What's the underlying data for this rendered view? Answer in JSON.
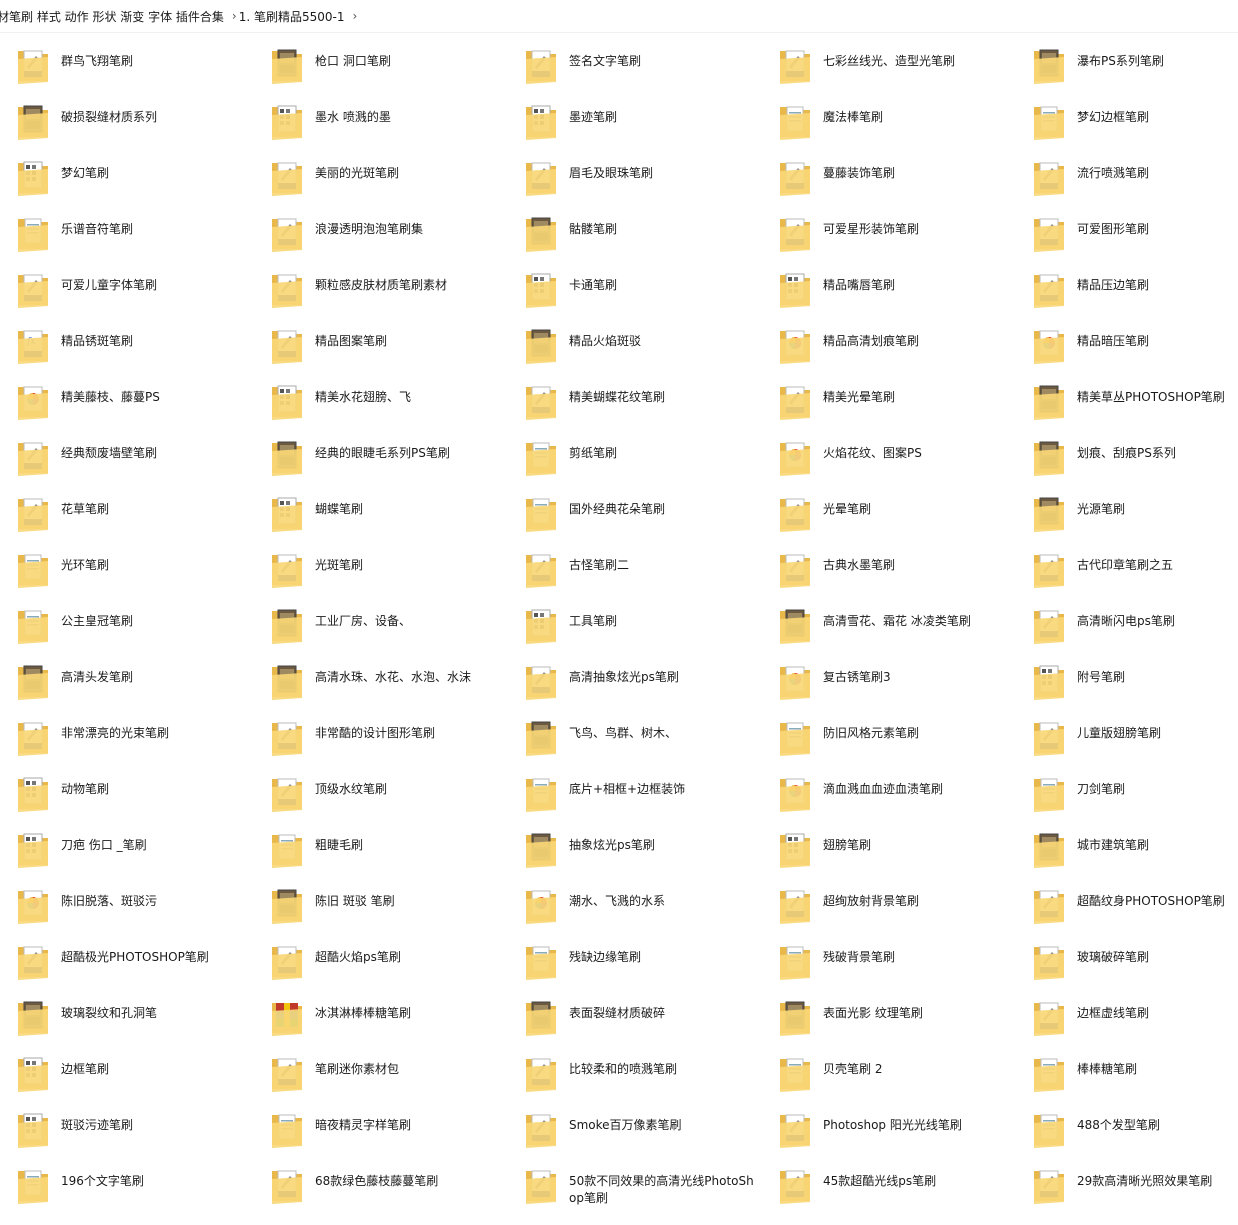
{
  "breadcrumb": {
    "items": [
      "材笔刷 样式 动作 形状 渐变 字体 插件合集",
      "1. 笔刷精品5500-1"
    ],
    "separator": "›"
  },
  "colors": {
    "folder_back": "#e8b84a",
    "folder_front": "#f8d775",
    "thumb_blue": "#1f3a93"
  },
  "folders": [
    {
      "name": "群鸟飞翔笔刷",
      "icon": "brushes-icon"
    },
    {
      "name": "枪口 洞口笔刷",
      "icon": "photo-icon"
    },
    {
      "name": "签名文字笔刷",
      "icon": "brushes-icon"
    },
    {
      "name": "七彩丝线光、造型光笔刷",
      "icon": "brushes-icon"
    },
    {
      "name": "瀑布PS系列笔刷",
      "icon": "photo-icon"
    },
    {
      "name": "破损裂缝材质系列",
      "icon": "photo-icon"
    },
    {
      "name": "墨水 喷溅的墨",
      "icon": "sheet-icon"
    },
    {
      "name": "墨迹笔刷",
      "icon": "sheet-icon"
    },
    {
      "name": "魔法棒笔刷",
      "icon": "doc-icon"
    },
    {
      "name": "梦幻边框笔刷",
      "icon": "doc-icon"
    },
    {
      "name": "梦幻笔刷",
      "icon": "sheet-icon"
    },
    {
      "name": "美丽的光斑笔刷",
      "icon": "brushes-icon"
    },
    {
      "name": "眉毛及眼珠笔刷",
      "icon": "brushes-icon"
    },
    {
      "name": "蔓藤装饰笔刷",
      "icon": "brushes-icon"
    },
    {
      "name": "流行喷溅笔刷",
      "icon": "brushes-icon"
    },
    {
      "name": "乐谱音符笔刷",
      "icon": "doc-icon"
    },
    {
      "name": "浪漫透明泡泡笔刷集",
      "icon": "brushes-icon"
    },
    {
      "name": "骷髅笔刷",
      "icon": "photo-icon"
    },
    {
      "name": "可爱星形装饰笔刷",
      "icon": "brushes-icon"
    },
    {
      "name": "可爱图形笔刷",
      "icon": "brushes-icon"
    },
    {
      "name": "可爱儿童字体笔刷",
      "icon": "brushes-icon"
    },
    {
      "name": "颗粒感皮肤材质笔刷素材",
      "icon": "brushes-icon"
    },
    {
      "name": "卡通笔刷",
      "icon": "sheet-icon"
    },
    {
      "name": "精品嘴唇笔刷",
      "icon": "sheet-icon"
    },
    {
      "name": "精品压边笔刷",
      "icon": "brushes-icon"
    },
    {
      "name": "精品锈斑笔刷",
      "icon": "fx-icon"
    },
    {
      "name": "精品图案笔刷",
      "icon": "brushes-icon"
    },
    {
      "name": "精品火焰斑驳",
      "icon": "photo-icon"
    },
    {
      "name": "精品高清划痕笔刷",
      "icon": "color-wheel-icon"
    },
    {
      "name": "精品暗压笔刷",
      "icon": "color-wheel-icon"
    },
    {
      "name": "精美藤枝、藤蔓PS",
      "icon": "color-wheel-icon"
    },
    {
      "name": "精美水花翅膀、飞",
      "icon": "sheet-icon"
    },
    {
      "name": "精美蝴蝶花纹笔刷",
      "icon": "brushes-icon"
    },
    {
      "name": "精美光晕笔刷",
      "icon": "brushes-icon"
    },
    {
      "name": "精美草丛PHOTOSHOP笔刷",
      "icon": "photo-icon"
    },
    {
      "name": "经典颓废墙壁笔刷",
      "icon": "brushes-icon"
    },
    {
      "name": "经典的眼睫毛系列PS笔刷",
      "icon": "photo-icon"
    },
    {
      "name": "剪纸笔刷",
      "icon": "doc-icon"
    },
    {
      "name": "火焰花纹、图案PS",
      "icon": "color-wheel-icon"
    },
    {
      "name": "划痕、刮痕PS系列",
      "icon": "photo-icon"
    },
    {
      "name": "花草笔刷",
      "icon": "brushes-icon"
    },
    {
      "name": "蝴蝶笔刷",
      "icon": "sheet-icon"
    },
    {
      "name": "国外经典花朵笔刷",
      "icon": "doc-icon"
    },
    {
      "name": "光晕笔刷",
      "icon": "brushes-icon"
    },
    {
      "name": "光源笔刷",
      "icon": "photo-icon"
    },
    {
      "name": "光环笔刷",
      "icon": "doc-icon"
    },
    {
      "name": "光斑笔刷",
      "icon": "brushes-icon"
    },
    {
      "name": "古怪笔刷二",
      "icon": "brushes-icon"
    },
    {
      "name": "古典水墨笔刷",
      "icon": "brushes-icon"
    },
    {
      "name": "古代印章笔刷之五",
      "icon": "brushes-icon"
    },
    {
      "name": "公主皇冠笔刷",
      "icon": "doc-icon"
    },
    {
      "name": "工业厂房、设备、",
      "icon": "photo-icon"
    },
    {
      "name": "工具笔刷",
      "icon": "sheet-icon"
    },
    {
      "name": "高清雪花、霜花 冰凌类笔刷",
      "icon": "photo-icon"
    },
    {
      "name": "高清晰闪电ps笔刷",
      "icon": "brushes-icon"
    },
    {
      "name": "高清头发笔刷",
      "icon": "photo-icon"
    },
    {
      "name": "高清水珠、水花、水泡、水沫",
      "icon": "photo-icon"
    },
    {
      "name": "高清抽象炫光ps笔刷",
      "icon": "brushes-icon"
    },
    {
      "name": "复古锈笔刷3",
      "icon": "color-wheel-icon"
    },
    {
      "name": "附号笔刷",
      "icon": "sheet-icon"
    },
    {
      "name": "非常漂亮的光束笔刷",
      "icon": "brushes-icon"
    },
    {
      "name": "非常酷的设计图形笔刷",
      "icon": "brushes-icon"
    },
    {
      "name": "飞鸟、鸟群、树木、",
      "icon": "photo-icon"
    },
    {
      "name": "防旧风格元素笔刷",
      "icon": "doc-icon"
    },
    {
      "name": "儿童版翅膀笔刷",
      "icon": "brushes-icon"
    },
    {
      "name": "动物笔刷",
      "icon": "sheet-icon"
    },
    {
      "name": "顶级水纹笔刷",
      "icon": "brushes-icon"
    },
    {
      "name": "底片+相框+边框装饰",
      "icon": "doc-icon"
    },
    {
      "name": "滴血溅血血迹血渍笔刷",
      "icon": "color-wheel-icon"
    },
    {
      "name": "刀剑笔刷",
      "icon": "doc-icon"
    },
    {
      "name": "刀疤 伤口 _笔刷",
      "icon": "sheet-icon"
    },
    {
      "name": "粗睫毛刷",
      "icon": "doc-icon"
    },
    {
      "name": "抽象炫光ps笔刷",
      "icon": "photo-icon"
    },
    {
      "name": "翅膀笔刷",
      "icon": "sheet-icon"
    },
    {
      "name": "城市建筑笔刷",
      "icon": "photo-icon"
    },
    {
      "name": "陈旧脱落、斑驳污",
      "icon": "color-wheel-icon"
    },
    {
      "name": "陈旧 斑驳 笔刷",
      "icon": "photo-icon"
    },
    {
      "name": "潮水、飞溅的水系",
      "icon": "color-wheel-icon"
    },
    {
      "name": "超绚放射背景笔刷",
      "icon": "brushes-icon"
    },
    {
      "name": "超酷纹身PHOTOSHOP笔刷",
      "icon": "brushes-icon"
    },
    {
      "name": "超酷极光PHOTOSHOP笔刷",
      "icon": "brushes-icon"
    },
    {
      "name": "超酷火焰ps笔刷",
      "icon": "brushes-icon"
    },
    {
      "name": "残缺边缘笔刷",
      "icon": "doc-icon"
    },
    {
      "name": "残破背景笔刷",
      "icon": "doc-icon"
    },
    {
      "name": "玻璃破碎笔刷",
      "icon": "brushes-icon"
    },
    {
      "name": "玻璃裂纹和孔洞笔",
      "icon": "photo-icon"
    },
    {
      "name": "冰淇淋棒棒糖笔刷",
      "icon": "archive-icon"
    },
    {
      "name": "表面裂缝材质破碎",
      "icon": "photo-icon"
    },
    {
      "name": "表面光影 纹理笔刷",
      "icon": "photo-icon"
    },
    {
      "name": "边框虚线笔刷",
      "icon": "brushes-icon"
    },
    {
      "name": "边框笔刷",
      "icon": "sheet-icon"
    },
    {
      "name": "笔刷迷你素材包",
      "icon": "brushes-icon"
    },
    {
      "name": "比较柔和的喷溅笔刷",
      "icon": "brushes-icon"
    },
    {
      "name": "贝壳笔刷 2",
      "icon": "doc-icon"
    },
    {
      "name": "棒棒糖笔刷",
      "icon": "doc-icon"
    },
    {
      "name": "斑驳污迹笔刷",
      "icon": "sheet-icon"
    },
    {
      "name": "暗夜精灵字样笔刷",
      "icon": "doc-icon"
    },
    {
      "name": "Smoke百万像素笔刷",
      "icon": "brushes-icon"
    },
    {
      "name": "Photoshop 阳光光线笔刷",
      "icon": "brushes-icon"
    },
    {
      "name": "488个发型笔刷",
      "icon": "doc-icon"
    },
    {
      "name": "196个文字笔刷",
      "icon": "doc-icon"
    },
    {
      "name": "68款绿色藤枝藤蔓笔刷",
      "icon": "brushes-icon"
    },
    {
      "name": "50款不同效果的高清光线PhotoShop笔刷",
      "icon": "brushes-icon"
    },
    {
      "name": "45款超酷光线ps笔刷",
      "icon": "brushes-icon"
    },
    {
      "name": "29款高清晰光照效果笔刷",
      "icon": "brushes-icon"
    }
  ]
}
